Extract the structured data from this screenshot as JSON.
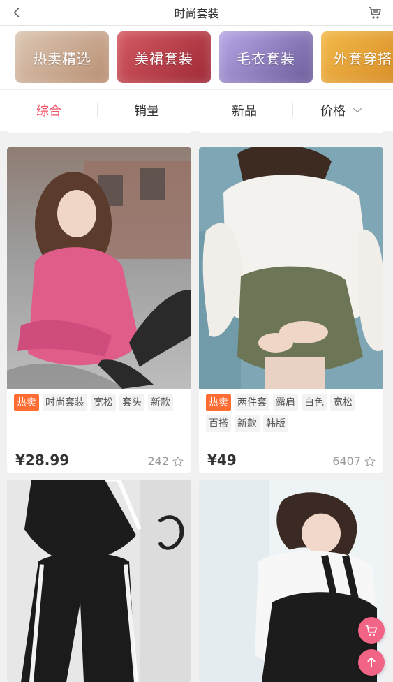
{
  "header": {
    "title": "时尚套装",
    "back_icon": "chevron-left-icon",
    "cart_icon": "cart-icon"
  },
  "categories": [
    {
      "label": "热卖精选",
      "colors": [
        "#dcc7b4",
        "#b98f72"
      ]
    },
    {
      "label": "美裙套装",
      "colors": [
        "#d45a63",
        "#9e2835"
      ]
    },
    {
      "label": "毛衣套装",
      "colors": [
        "#b8a7e6",
        "#6b5b9a"
      ]
    },
    {
      "label": "外套穿搭",
      "colors": [
        "#f2b94a",
        "#d78c26"
      ]
    }
  ],
  "sort": {
    "items": [
      "综合",
      "销量",
      "新品",
      "价格"
    ],
    "active_index": 0,
    "active_color": "#f05167"
  },
  "products": [
    {
      "tags": [
        "热卖",
        "时尚套装",
        "宽松",
        "套头",
        "新款"
      ],
      "price": "¥28.99",
      "likes": "242",
      "image_colors": [
        "#a6a6a6",
        "#e05d8a",
        "#c2c2c2"
      ]
    },
    {
      "tags": [
        "热卖",
        "两件套",
        "露肩",
        "白色",
        "宽松",
        "百搭",
        "新款",
        "韩版"
      ],
      "price": "¥49",
      "likes": "6407",
      "image_colors": [
        "#7ea6b4",
        "#f4f2ee",
        "#6c7656"
      ]
    },
    {
      "tags": [],
      "price": "",
      "likes": "",
      "image_colors": [
        "#e7e7e7",
        "#1c1c1c",
        "#ffffff"
      ]
    },
    {
      "tags": [],
      "price": "",
      "likes": "",
      "image_colors": [
        "#eef3f6",
        "#f7f7f7",
        "#1c1c1c"
      ]
    }
  ],
  "fabs": {
    "cart_icon": "cart-icon",
    "up_icon": "arrow-up-icon"
  },
  "colors": {
    "hot_tag": "#ff6d33",
    "accent": "#f05167",
    "fab": "#f26486"
  }
}
